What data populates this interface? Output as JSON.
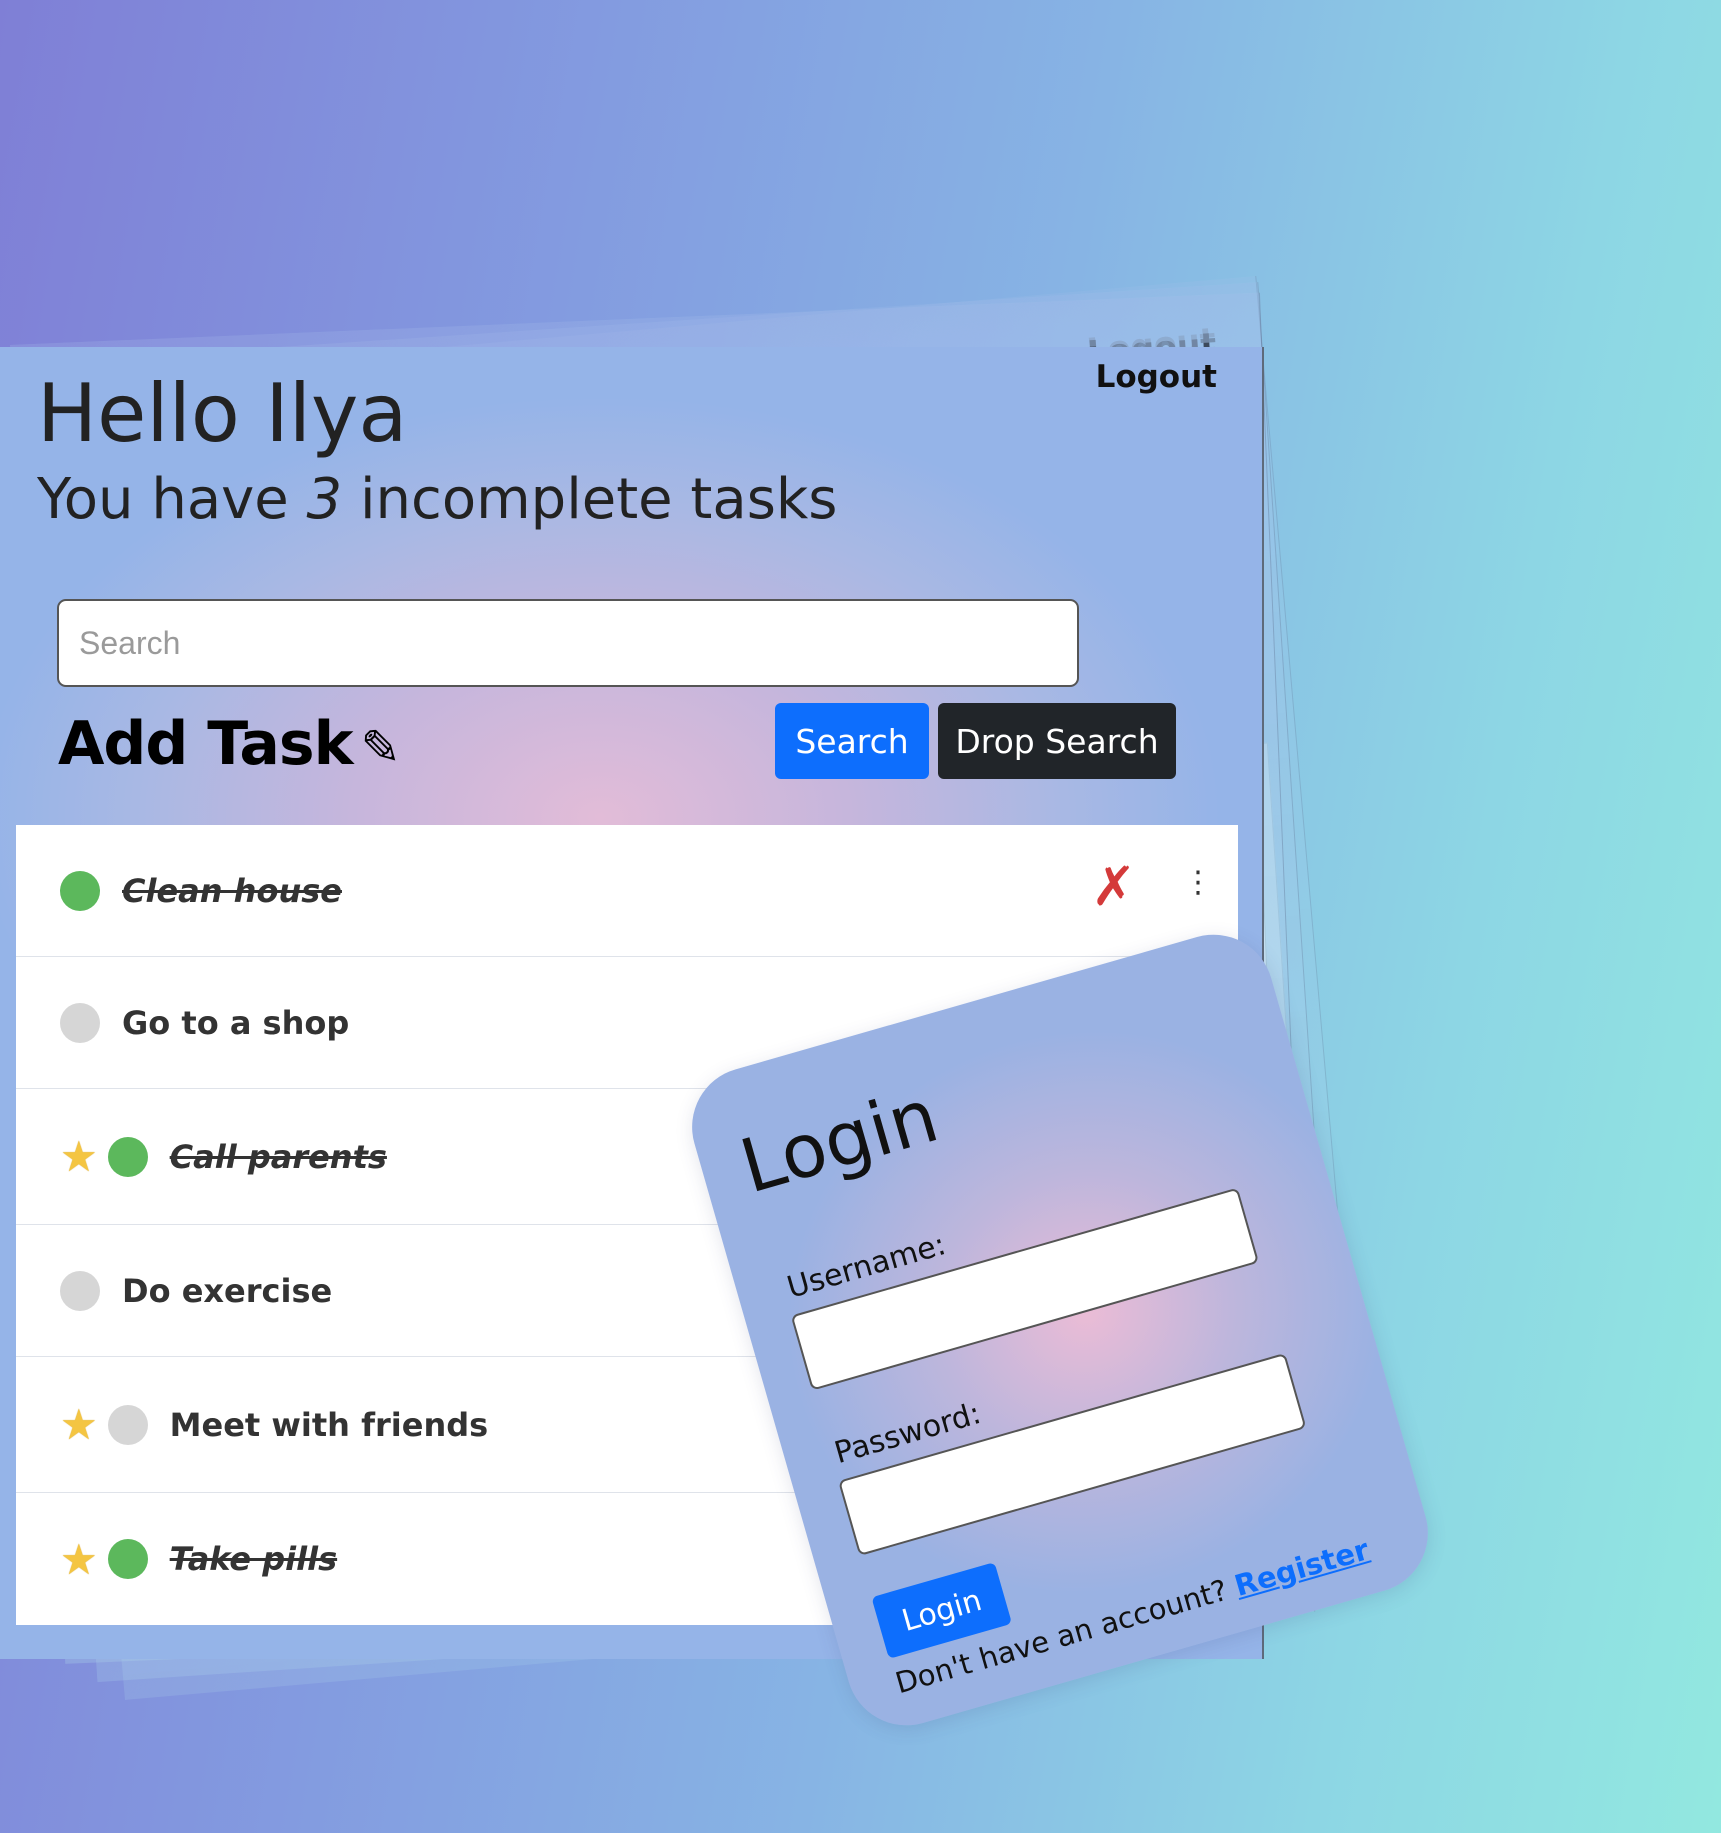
{
  "header": {
    "greeting": "Hello Ilya",
    "subtitle_prefix": "You have",
    "incomplete_count": "3",
    "subtitle_suffix": "incomplete tasks",
    "logout_label": "Logout"
  },
  "search": {
    "placeholder": "Search",
    "value": "",
    "search_button": "Search",
    "drop_button": "Drop Search"
  },
  "add_task": {
    "label": "Add Task",
    "icon": "pencil-icon"
  },
  "tasks": [
    {
      "title": "Clean house",
      "completed": true,
      "starred": false
    },
    {
      "title": "Go to a shop",
      "completed": false,
      "starred": false
    },
    {
      "title": "Call parents",
      "completed": true,
      "starred": true
    },
    {
      "title": "Do exercise",
      "completed": false,
      "starred": false
    },
    {
      "title": "Meet with friends",
      "completed": false,
      "starred": true
    },
    {
      "title": "Take pills",
      "completed": true,
      "starred": true
    }
  ],
  "task_actions": {
    "delete_icon": "cross-mark-icon",
    "delete_symbol": "✗",
    "menu_symbol": "⋮"
  },
  "login": {
    "title": "Login",
    "username_label": "Username:",
    "password_label": "Password:",
    "button_label": "Login",
    "no_account_text": "Don't have an account?",
    "register_link": "Register"
  },
  "colors": {
    "primary": "#0d6efd",
    "dark": "#212529",
    "completed_dot": "#5cb85c",
    "incomplete_dot": "#d6d6d6",
    "delete": "#d43a3a"
  }
}
